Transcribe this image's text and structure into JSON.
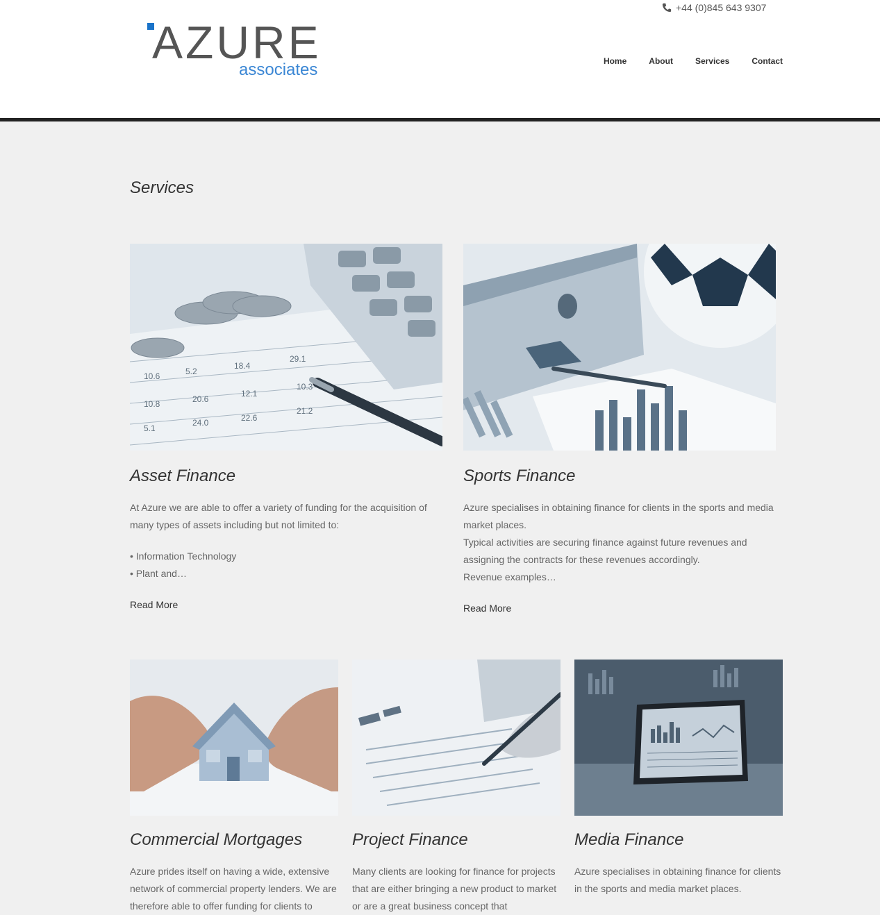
{
  "header": {
    "phone": "+44 (0)845 643 9307",
    "logo": {
      "word": "AZURE",
      "sub": "associates"
    },
    "nav": [
      "Home",
      "About",
      "Services",
      "Contact"
    ]
  },
  "page": {
    "title": "Services"
  },
  "services": [
    {
      "title": "Asset Finance",
      "text": "At Azure we are able to offer a variety of funding for the acquisition of many types of assets including but not limited to:",
      "bullets": [
        "• Information Technology",
        "• Plant and…"
      ],
      "link": "Read More"
    },
    {
      "title": "Sports Finance",
      "text": "Azure specialises in obtaining finance for clients in the sports and media market places.",
      "text2": "Typical activities are securing finance against future revenues and assigning the contracts for these revenues accordingly.",
      "text3": "Revenue examples…",
      "link": "Read More"
    },
    {
      "title": "Commercial Mortgages",
      "text": "Azure prides itself on having a wide, extensive network of commercial property lenders. We are therefore able to offer funding for clients to"
    },
    {
      "title": "Project Finance",
      "text": "Many clients are looking for finance for projects that are either bringing a new product to market or are a great business concept that"
    },
    {
      "title": "Media Finance",
      "text": "Azure specialises in obtaining finance for clients in the sports and media market places."
    }
  ],
  "colors": {
    "accent": "#1a73c9",
    "dark": "#222222",
    "background": "#f0f0f0"
  }
}
